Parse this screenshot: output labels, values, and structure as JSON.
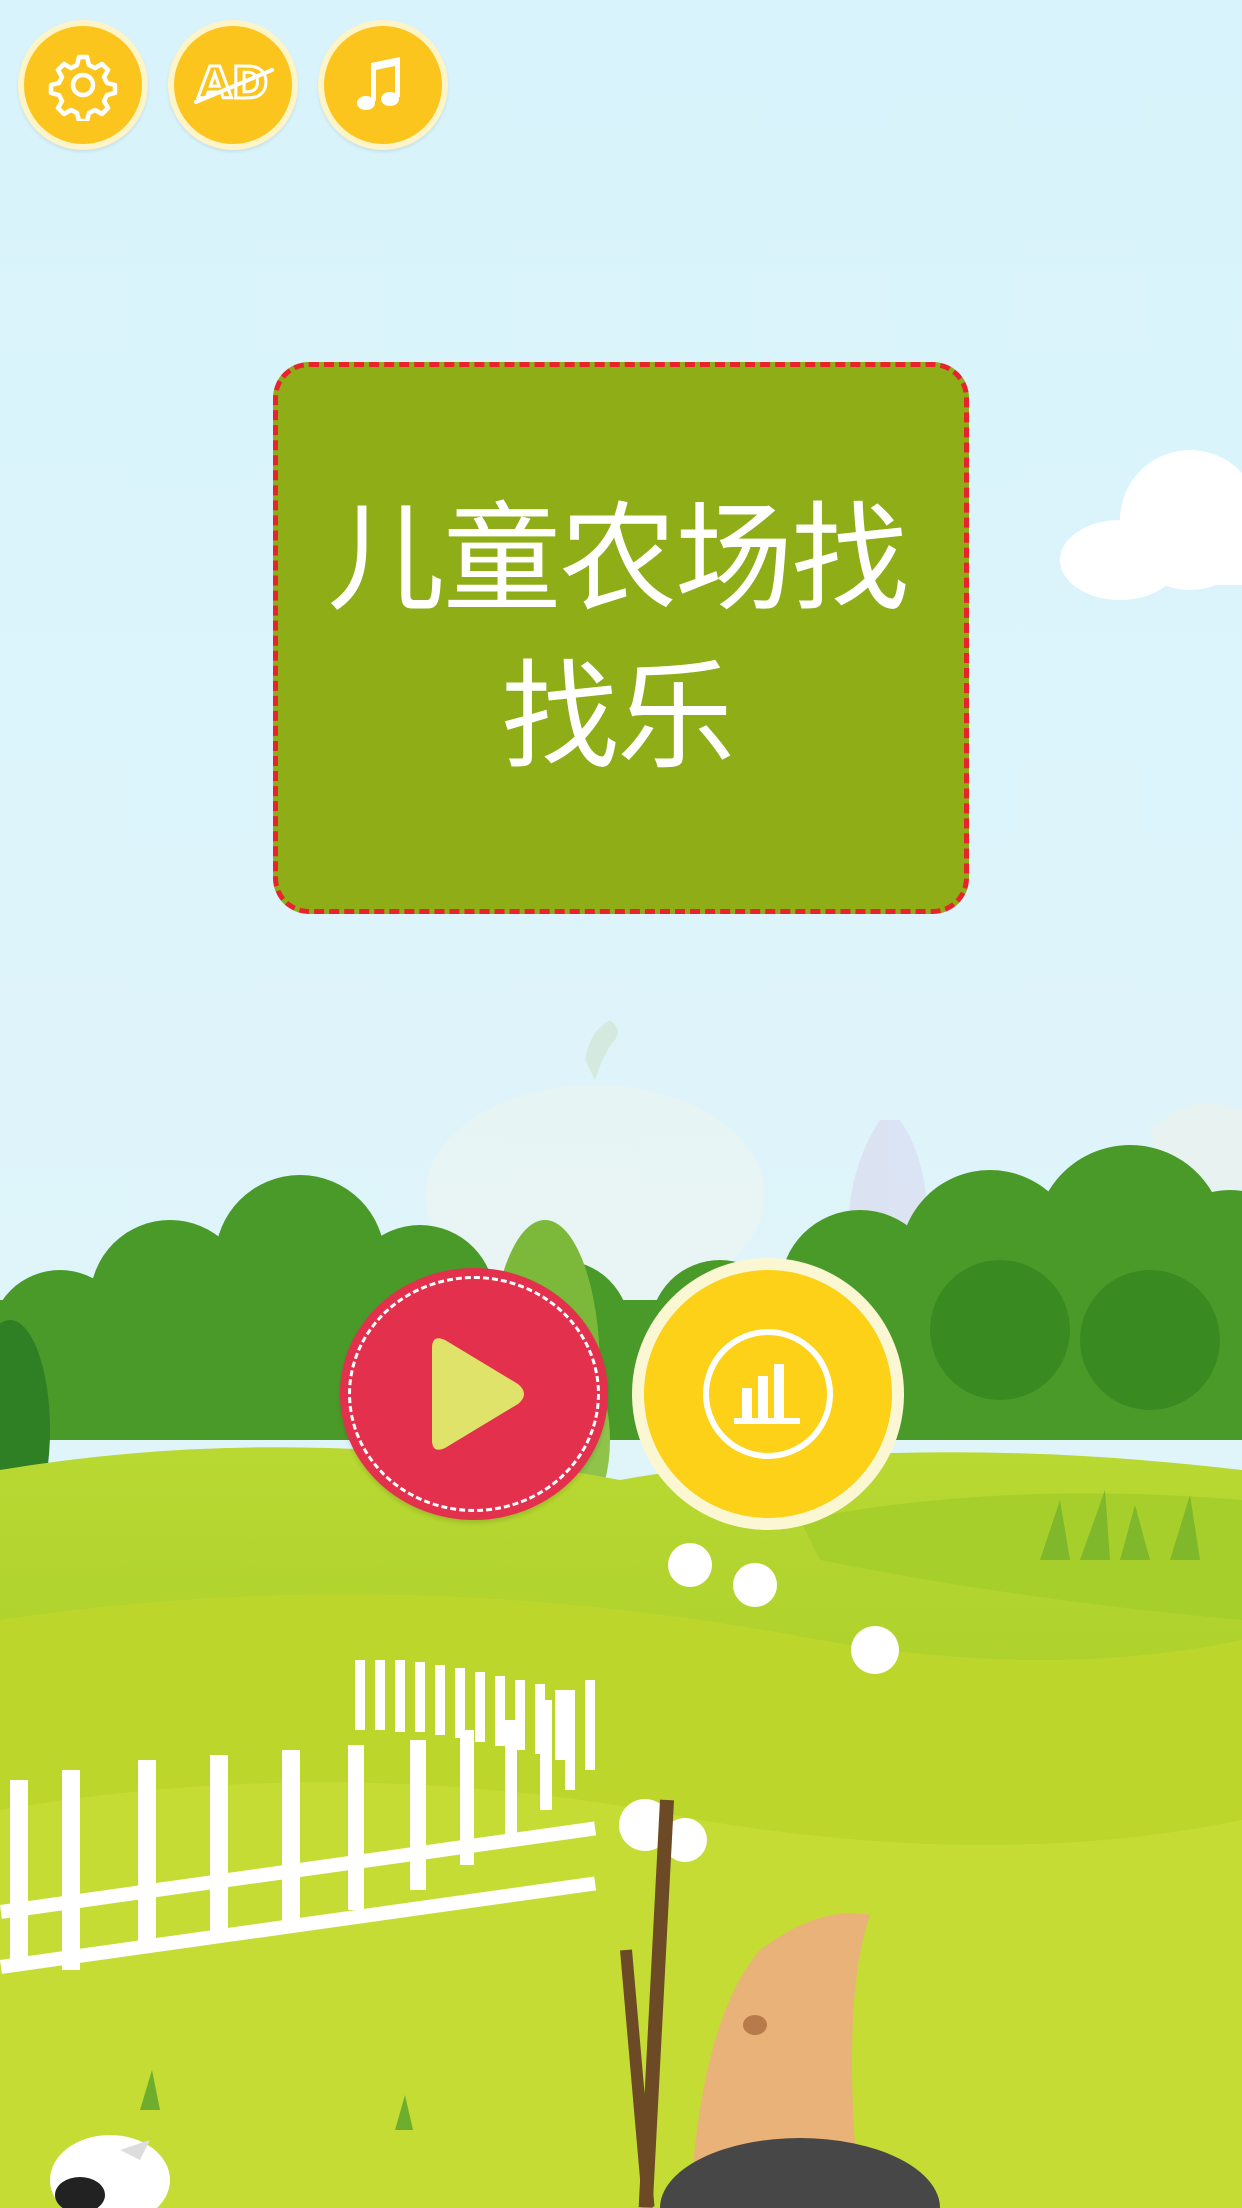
{
  "app": {
    "title": "儿童农场找找乐"
  },
  "toolbar": {
    "items": [
      {
        "name": "settings",
        "icon": "gear-icon"
      },
      {
        "name": "remove-ads",
        "icon": "ad-crossed-icon",
        "text": "AD"
      },
      {
        "name": "music",
        "icon": "music-note-icon"
      }
    ]
  },
  "main_menu": {
    "play_icon": "play-icon",
    "leaderboard_icon": "bar-chart-icon"
  },
  "colors": {
    "sky": "#d8f2fa",
    "title_card": "#8ead16",
    "title_border": "#e8232c",
    "play_button": "#e3304d",
    "play_triangle": "#e0e36a",
    "yellow_button": "#fbc51d",
    "leaderboard_button": "#fcd117",
    "grass_light": "#b6d42a",
    "grass_dark": "#6aa023",
    "bush": "#4a9a2a"
  }
}
